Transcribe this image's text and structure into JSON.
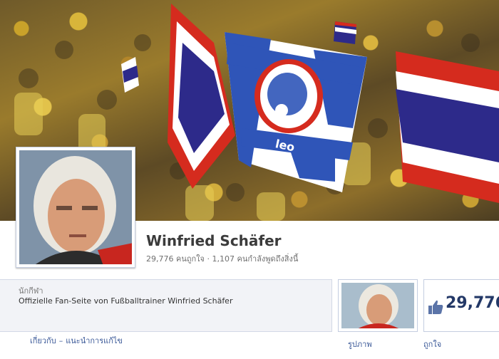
{
  "page": {
    "name": "Winfried Schäfer",
    "stats": "29,776 คนถูกใจ · 1,107 คนกำลังพูดถึงสิ่งนี้",
    "category": "นักกีฬา",
    "description": "Offizielle Fan-Seite von Fußballtrainer Winfried Schäfer"
  },
  "links": {
    "about": "เกี่ยวกับ",
    "separator": "–",
    "suggest_edit": "แนะนำการแก้ไข"
  },
  "tiles": {
    "photos_label": "รูปภาพ",
    "likes_count": "29,776",
    "likes_label": "ถูกใจ"
  },
  "cover": {
    "banner_text": "leo"
  },
  "colors": {
    "link": "#3b5998",
    "thai_red": "#d52b1e",
    "thai_blue": "#2d2a8a",
    "banner_blue": "#2f55b8"
  }
}
